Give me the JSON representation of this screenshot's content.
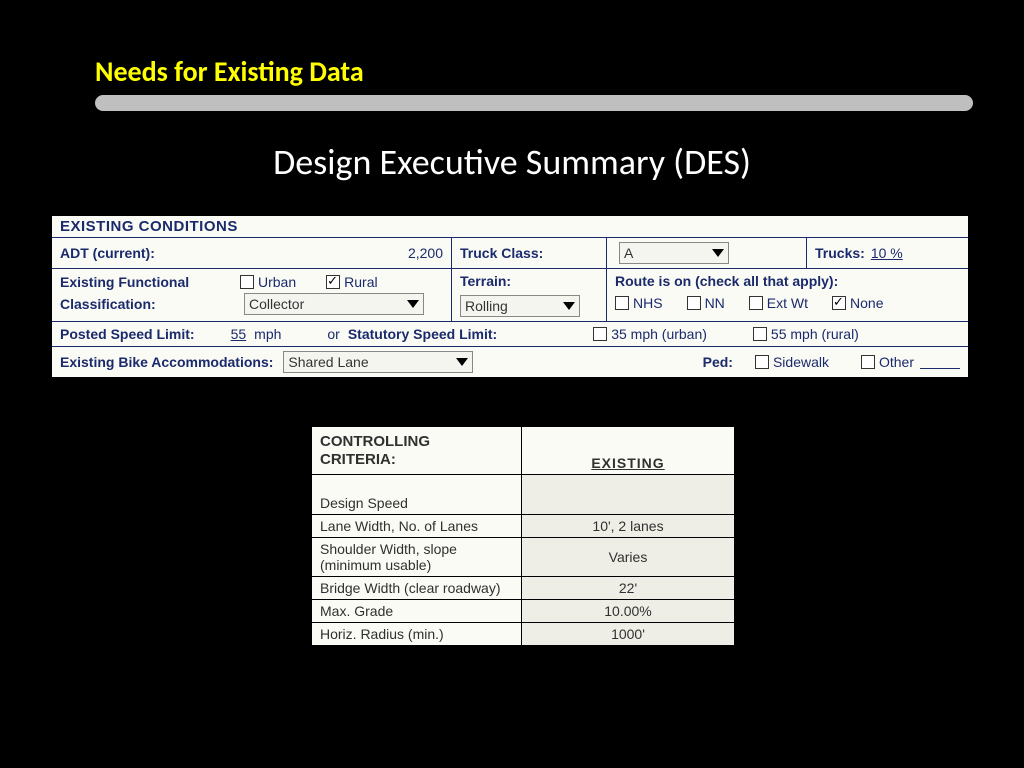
{
  "slide": {
    "title": "Needs for Existing Data",
    "heading": "Design Executive Summary (DES)"
  },
  "form": {
    "section_header": "EXISTING CONDITIONS",
    "adt_label": "ADT (current):",
    "adt_value": "2,200",
    "truck_class_label": "Truck Class:",
    "truck_class_value": "A",
    "trucks_label": "Trucks:",
    "trucks_value": "10 %",
    "func_class_label_1": "Existing Functional",
    "func_class_label_2": "Classification:",
    "urban_label": "Urban",
    "rural_label": "Rural",
    "classification_value": "Collector",
    "terrain_label": "Terrain:",
    "terrain_value": "Rolling",
    "route_label": "Route is on (check all that apply):",
    "route_nhs": "NHS",
    "route_nn": "NN",
    "route_extwt": "Ext Wt",
    "route_none": "None",
    "posted_speed_label": "Posted Speed Limit:",
    "posted_speed_value": "55",
    "posted_speed_unit": "mph",
    "or_label": "or",
    "statutory_label": "Statutory Speed Limit:",
    "stat_urban": "35 mph (urban)",
    "stat_rural": "55 mph (rural)",
    "bike_label": "Existing Bike Accommodations:",
    "bike_value": "Shared Lane",
    "ped_label": "Ped:",
    "ped_sidewalk": "Sidewalk",
    "ped_other": "Other"
  },
  "criteria": {
    "header_left": "CONTROLLING CRITERIA:",
    "header_right": "EXISTING",
    "rows": [
      {
        "label": "Design Speed",
        "value": ""
      },
      {
        "label": "Lane Width, No. of Lanes",
        "value": "10', 2 lanes"
      },
      {
        "label": "Shoulder Width, slope (minimum usable)",
        "value": "Varies"
      },
      {
        "label": "Bridge Width (clear roadway)",
        "value": "22'"
      },
      {
        "label": "Max. Grade",
        "value": "10.00%"
      },
      {
        "label": "Horiz. Radius (min.)",
        "value": "1000'"
      }
    ]
  }
}
